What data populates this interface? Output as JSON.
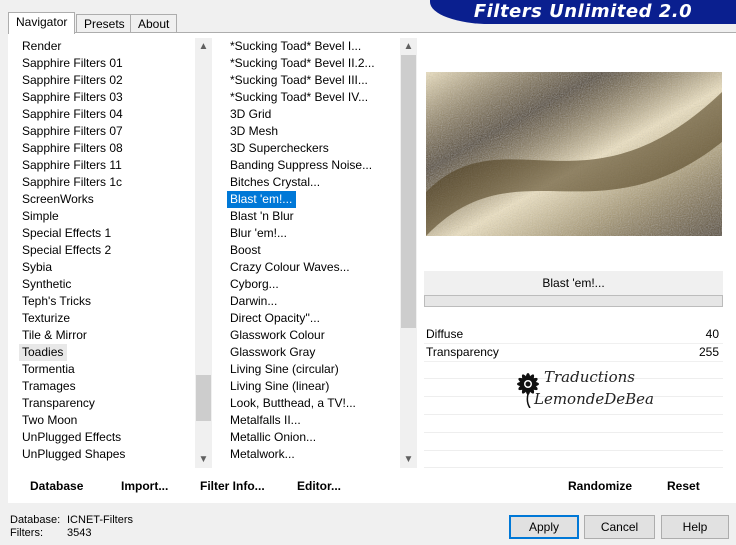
{
  "tabs": [
    "Navigator",
    "Presets",
    "About"
  ],
  "banner_title": "Filters Unlimited 2.0",
  "categories": [
    "Render",
    "Sapphire Filters 01",
    "Sapphire Filters 02",
    "Sapphire Filters 03",
    "Sapphire Filters 04",
    "Sapphire Filters 07",
    "Sapphire Filters 08",
    "Sapphire Filters 11",
    "Sapphire Filters 1c",
    "ScreenWorks",
    "Simple",
    "Special Effects 1",
    "Special Effects 2",
    "Sybia",
    "Synthetic",
    "Teph's Tricks",
    "Texturize",
    "Tile & Mirror",
    "Toadies",
    "Tormentia",
    "Tramages",
    "Transparency",
    "Two Moon",
    "UnPlugged Effects",
    "UnPlugged Shapes"
  ],
  "selected_category": "Toadies",
  "filters": [
    "*Sucking Toad*  Bevel I...",
    "*Sucking Toad*  Bevel II.2...",
    "*Sucking Toad*  Bevel III...",
    "*Sucking Toad*  Bevel IV...",
    "3D Grid",
    "3D Mesh",
    "3D Supercheckers",
    "Banding Suppress Noise...",
    "Bitches Crystal...",
    "Blast 'em!...",
    "Blast 'n Blur",
    "Blur 'em!...",
    "Boost",
    "Crazy Colour Waves...",
    "Cyborg...",
    "Darwin...",
    "Direct Opacity''...",
    "Glasswork Colour",
    "Glasswork Gray",
    "Living Sine (circular)",
    "Living Sine (linear)",
    "Look, Butthead, a TV!...",
    "Metalfalls II...",
    "Metallic Onion...",
    "Metalwork..."
  ],
  "selected_filter": "Blast 'em!...",
  "preview_colors": {
    "dark": "#4a3a1a",
    "mid": "#a99a72",
    "light": "#efe3c2"
  },
  "filter_name": "Blast 'em!...",
  "progress": 0,
  "params": [
    {
      "label": "Diffuse",
      "value": "40"
    },
    {
      "label": "Transparency",
      "value": "255"
    }
  ],
  "watermark": {
    "line1": "Traductions",
    "line2": "LemondeDeBea"
  },
  "bottom_buttons": {
    "database": "Database",
    "import": "Import...",
    "filter_info": "Filter Info...",
    "editor": "Editor...",
    "randomize": "Randomize",
    "reset": "Reset"
  },
  "status": {
    "database_label": "Database:",
    "database_value": "ICNET-Filters",
    "filters_label": "Filters:",
    "filters_value": "3543"
  },
  "dialog_buttons": {
    "apply": "Apply",
    "cancel": "Cancel",
    "help": "Help"
  },
  "accent_color": "#0078d7",
  "banner_color": "#0a1f8f"
}
